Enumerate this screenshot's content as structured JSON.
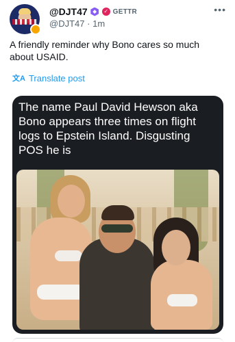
{
  "post": {
    "display_name": "@DJT47",
    "platform": "GETTR",
    "handle": "@DJT47",
    "separator": "·",
    "time": "1m",
    "text": "A friendly reminder why Bono cares so much about USAID.",
    "translate_label": "Translate post",
    "more_icon": "•••"
  },
  "media": {
    "caption": "The name Paul David Hewson aka Bono appears three times on flight logs to Epstein Island. Disgusting POS he is"
  },
  "icons": {
    "verified_hex": "hexagon-badge-icon",
    "verified_check": "check-badge-icon",
    "translate": "translate-icon",
    "more": "more-icon"
  },
  "colors": {
    "link": "#1d9bf0",
    "muted": "#536471",
    "badge_purple": "#8a5cf6",
    "badge_red": "#e0245e",
    "card_bg": "#1a1d21"
  }
}
